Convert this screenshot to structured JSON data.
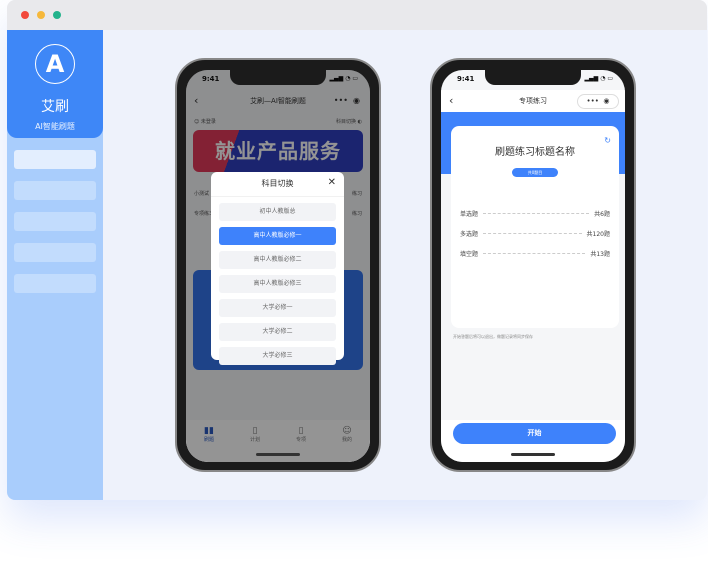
{
  "sidebar": {
    "app_name": "艾刷",
    "app_sub": "AI智能刷题",
    "logo_letter": "A"
  },
  "phone1": {
    "time": "9:41",
    "nav_title": "艾刷—AI智能刷题",
    "user": "未登录",
    "switch": "科目切换",
    "banner": "就业产品服务",
    "menu": [
      "小测试",
      "练习",
      "专项练习",
      "练习"
    ],
    "modal": {
      "title": "科目切换",
      "options": [
        "初中人教版总",
        "高中人教版必修一",
        "高中人教版必修二",
        "高中人教版必修三",
        "大学必修一",
        "大学必修二",
        "大学必修三"
      ],
      "selected": 1
    },
    "tabs": [
      {
        "label": "刷题",
        "icon": "book-icon"
      },
      {
        "label": "计划",
        "icon": "bookmark-icon"
      },
      {
        "label": "专项",
        "icon": "document-icon"
      },
      {
        "label": "我的",
        "icon": "user-icon"
      }
    ]
  },
  "phone2": {
    "time": "9:41",
    "nav_title": "专项练习",
    "card_title": "刷题练习标题名称",
    "badge": "共0题目",
    "rows": [
      {
        "label": "单选题",
        "count": "共6题"
      },
      {
        "label": "多选题",
        "count": "共120题"
      },
      {
        "label": "填空题",
        "count": "共13题"
      }
    ],
    "note": "开始答题后将可以退出，做题记录将同步保存",
    "start": "开始"
  },
  "colors": {
    "accent": "#3e82fb",
    "sidebar": "#a9cdfc"
  }
}
